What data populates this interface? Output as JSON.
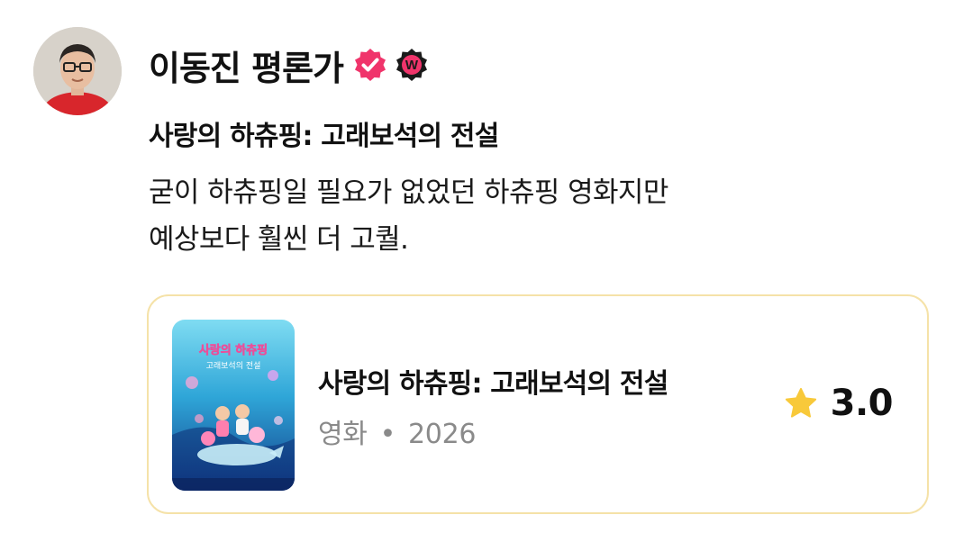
{
  "author": {
    "name": "이동진 평론가",
    "badge_letter": "W"
  },
  "review": {
    "title": "사랑의 하츄핑: 고래보석의 전설",
    "lines": [
      "굳이 하츄핑일 필요가 없었던 하츄핑 영화지만",
      "예상보다 훨씬 더 고퀄."
    ]
  },
  "movie_card": {
    "title": "사랑의 하츄핑: 고래보석의 전설",
    "category": "영화",
    "separator": "•",
    "year": "2026",
    "rating": "3.0",
    "poster": {
      "title_line1": "사랑의 하츄핑",
      "title_line2": "고래보석의 전설"
    }
  },
  "colors": {
    "verified_badge": "#f0346b",
    "w_badge_bg": "#1a1a1a",
    "w_badge_letter": "#f0346b",
    "card_border": "#f5e2a8",
    "star": "#f8c93a",
    "meta_text": "#8a8a8a"
  },
  "icons": [
    "verified-check-icon",
    "w-badge-icon",
    "star-icon"
  ]
}
